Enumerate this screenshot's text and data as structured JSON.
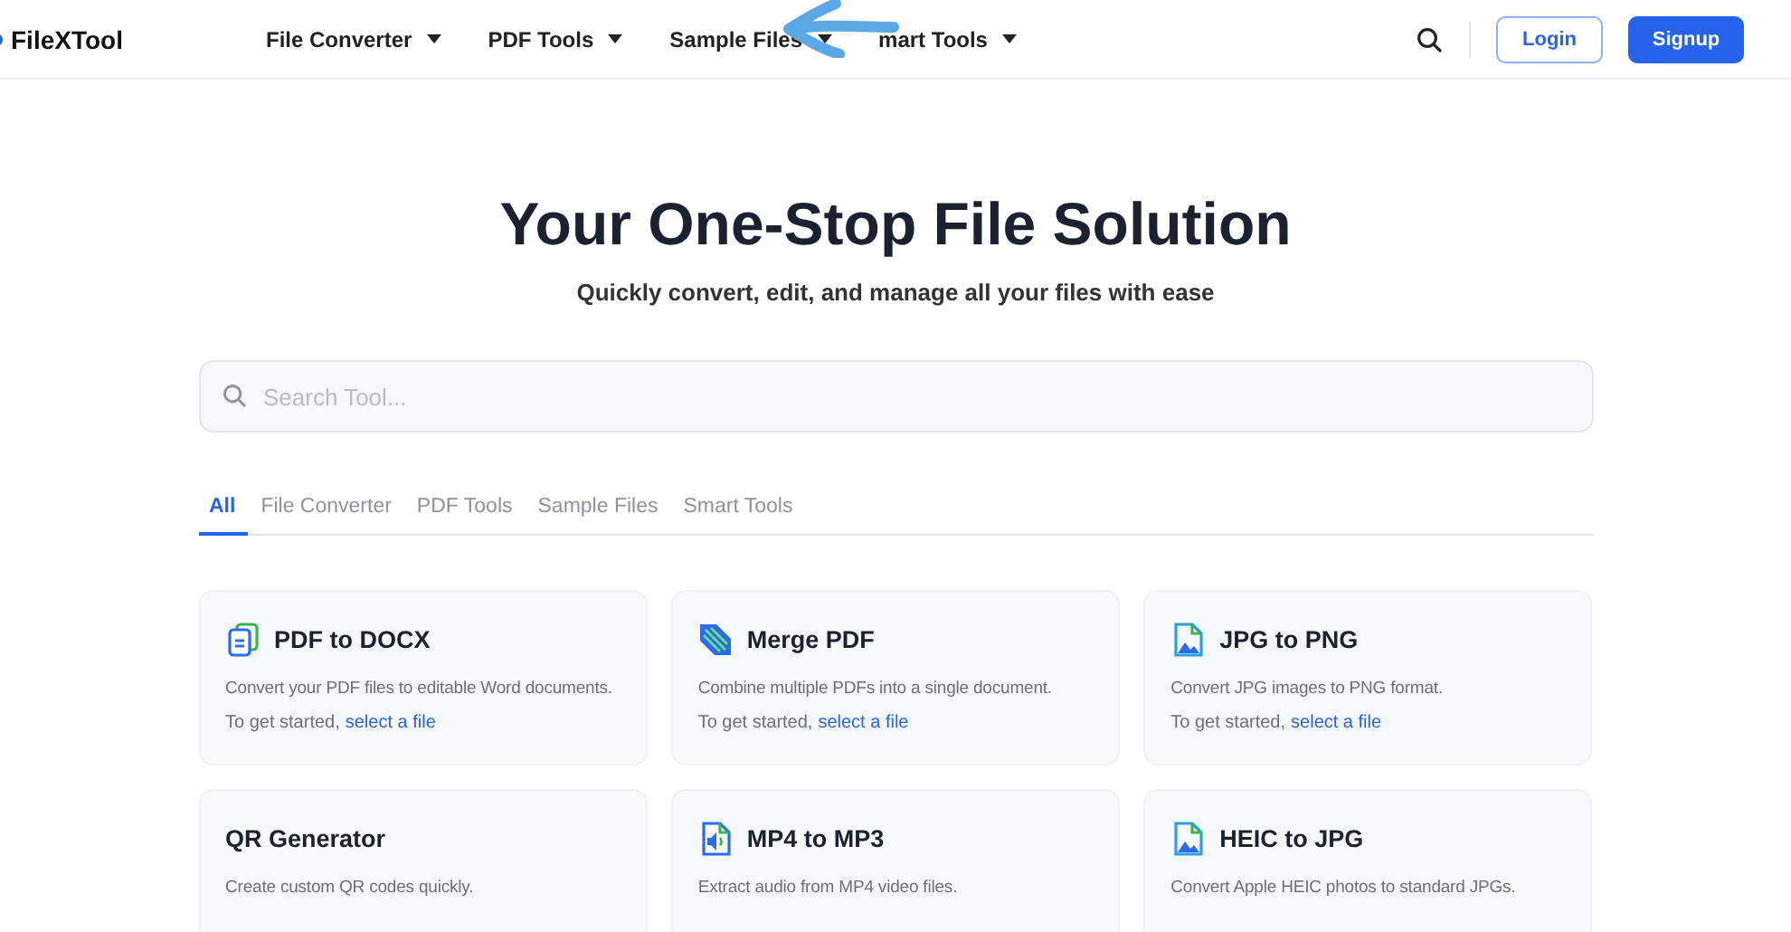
{
  "header": {
    "logo": "FileXTool",
    "nav": [
      {
        "label": "File Converter"
      },
      {
        "label": "PDF Tools"
      },
      {
        "label": "Sample Files"
      },
      {
        "label": "mart Tools"
      }
    ],
    "login": "Login",
    "signup": "Signup"
  },
  "hero": {
    "title": "Your One-Stop File Solution",
    "subtitle": "Quickly convert, edit, and manage all your files with ease"
  },
  "search": {
    "placeholder": "Search Tool..."
  },
  "tabs": [
    {
      "label": "All",
      "selected": true
    },
    {
      "label": "File Converter",
      "selected": false
    },
    {
      "label": "PDF Tools",
      "selected": false
    },
    {
      "label": "Sample Files",
      "selected": false
    },
    {
      "label": "Smart Tools",
      "selected": false
    }
  ],
  "cards": [
    {
      "kind": "document",
      "title": "PDF to DOCX",
      "description": "Convert your PDF files to editable Word documents.",
      "prompt": "To get started,",
      "link": "select a file"
    },
    {
      "kind": "merge",
      "title": "Merge PDF",
      "description": "Combine multiple PDFs into a single document.",
      "prompt": "To get started,",
      "link": "select a file"
    },
    {
      "kind": "image",
      "title": "JPG to PNG",
      "description": "Convert JPG images to PNG format.",
      "prompt": "To get started,",
      "link": "select a file"
    },
    {
      "kind": "none",
      "title": "QR Generator",
      "description": "Create custom QR codes quickly."
    },
    {
      "kind": "audio",
      "title": "MP4 to MP3",
      "description": "Extract audio from MP4 video files."
    },
    {
      "kind": "image",
      "title": "HEIC to JPG",
      "description": "Convert Apple HEIC photos to standard JPGs."
    }
  ]
}
